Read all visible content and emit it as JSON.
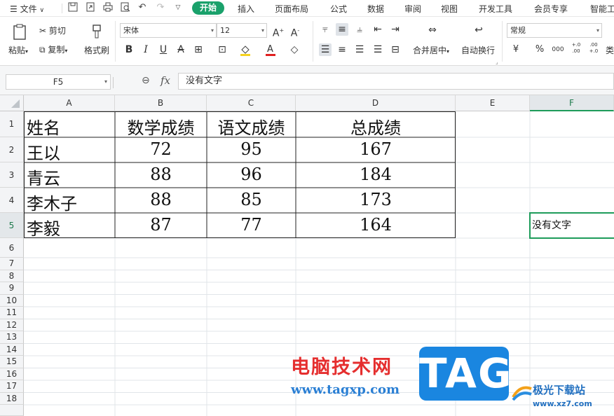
{
  "menubar": {
    "file_label": "文件",
    "tabs": [
      "开始",
      "插入",
      "页面布局",
      "公式",
      "数据",
      "审阅",
      "视图",
      "开发工具",
      "会员专享",
      "智能工"
    ]
  },
  "ribbon": {
    "paste": "粘贴",
    "cut": "剪切",
    "copy": "复制",
    "format_painter": "格式刷",
    "font_name": "宋体",
    "font_size": "12",
    "merge_center": "合并居中",
    "wrap_text": "自动换行",
    "number_format": "常规",
    "currency_symbol": "¥",
    "percent_symbol": "%",
    "thousands_symbol": "000",
    "inc_decimal": "+.0 .00",
    "dec_decimal": ".00 +.0",
    "more_label": "类"
  },
  "formula_bar": {
    "name_box": "F5",
    "fx": "fx",
    "content": "没有文字"
  },
  "sheet": {
    "columns": [
      "A",
      "B",
      "C",
      "D",
      "E",
      "F"
    ],
    "rows": [
      "1",
      "2",
      "3",
      "4",
      "5",
      "6",
      "7",
      "8",
      "9",
      "10",
      "11",
      "12",
      "13",
      "14",
      "15",
      "16",
      "17",
      "18"
    ],
    "table": [
      [
        "姓名",
        "数学成绩",
        "语文成绩",
        "总成绩"
      ],
      [
        "王以",
        "72",
        "95",
        "167"
      ],
      [
        "青云",
        "88",
        "96",
        "184"
      ],
      [
        "李木子",
        "88",
        "85",
        "173"
      ],
      [
        "李毅",
        "87",
        "77",
        "164"
      ]
    ],
    "f5": "没有文字",
    "selected_cell": "F5"
  },
  "watermark": {
    "site_name": "电脑技术网",
    "site_url": "www.tagxp.com",
    "tag": "TAG",
    "site2_name": "极光下载站",
    "site2_url": "www.xz7.com"
  },
  "colors": {
    "accent_green": "#1aa16b",
    "selection_border": "#1e9c5a"
  }
}
